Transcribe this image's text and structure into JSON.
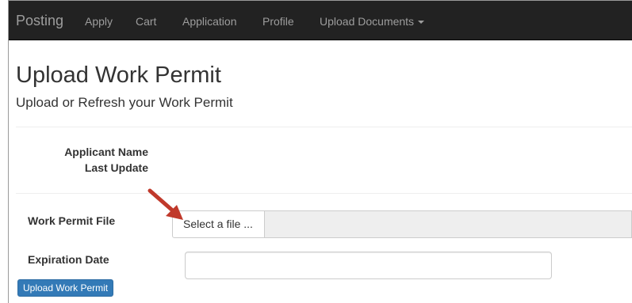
{
  "navbar": {
    "brand": "Posting",
    "items": [
      {
        "label": "Apply"
      },
      {
        "label": "Cart"
      },
      {
        "label": "Application"
      },
      {
        "label": "Profile"
      },
      {
        "label": "Upload Documents"
      }
    ],
    "background_color": "#222222",
    "link_color": "#9d9d9d"
  },
  "header": {
    "title": "Upload Work Permit",
    "subtitle": "Upload or Refresh your Work Permit"
  },
  "info": {
    "applicant_name_label": "Applicant Name",
    "last_update_label": "Last Update"
  },
  "form": {
    "work_permit_file_label": "Work Permit File",
    "select_file_label": "Select a file ...",
    "file_name_value": "",
    "expiration_date_label": "Expiration Date",
    "expiration_date_value": ""
  },
  "actions": {
    "upload_label": "Upload Work Permit",
    "primary_color": "#337ab7"
  },
  "annotation": {
    "arrow_icon": "arrow-pointer-icon",
    "arrow_color": "#c0392b"
  }
}
